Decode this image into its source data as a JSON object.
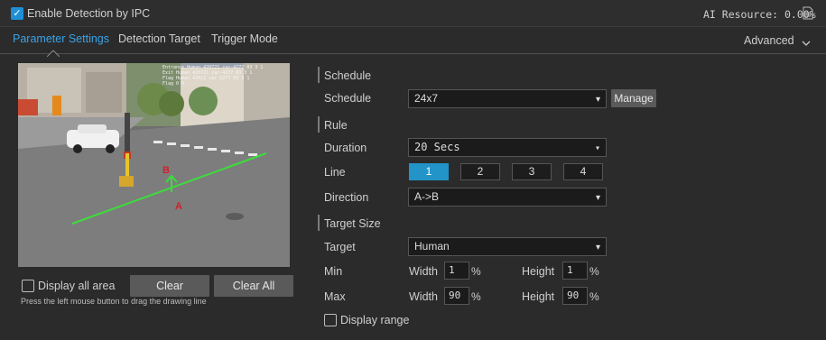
{
  "header": {
    "enable_label": "Enable Detection by IPC",
    "enable_checked": true,
    "ai_resource_label": "AI Resource: 0.00%",
    "doc_icon": "document-icon"
  },
  "tabs": [
    {
      "label": "Parameter Settings",
      "active": true
    },
    {
      "label": "Detection Target",
      "active": false
    },
    {
      "label": "Trigger Mode",
      "active": false
    }
  ],
  "advanced": {
    "label": "Advanced",
    "icon": "chevron-down-icon"
  },
  "preview": {
    "overlay_lines": [
      "Entrance  Human 420721 car-4277 03 3 1",
      "Exit     Human 420721 car-4277 03 3 1",
      "Flag     Human 42022 car 2277 03 3 1",
      "Flag  0 0 ..."
    ],
    "point_a": "A",
    "point_b": "B",
    "display_all_area_label": "Display all area",
    "clear_label": "Clear",
    "clear_all_label": "Clear All",
    "hint": "Press the left mouse button to drag the drawing line"
  },
  "form": {
    "schedule_section": "Schedule",
    "schedule_label": "Schedule",
    "schedule_value": "24x7",
    "manage_label": "Manage",
    "rule_section": "Rule",
    "duration_label": "Duration",
    "duration_value": "20 Secs",
    "line_label": "Line",
    "lines": [
      "1",
      "2",
      "3",
      "4"
    ],
    "line_active": "1",
    "direction_label": "Direction",
    "direction_value": "A->B",
    "target_size_section": "Target Size",
    "target_label": "Target",
    "target_value": "Human",
    "min_label": "Min",
    "max_label": "Max",
    "width_label": "Width",
    "height_label": "Height",
    "min_width": "1",
    "min_height": "1",
    "max_width": "90",
    "max_height": "90",
    "percent": "%",
    "display_range_label": "Display range"
  },
  "colors": {
    "accent": "#3aa3e8",
    "line_button_active": "#2294c8",
    "tripwire": "#3ddc3d",
    "marker": "#d4202a"
  }
}
